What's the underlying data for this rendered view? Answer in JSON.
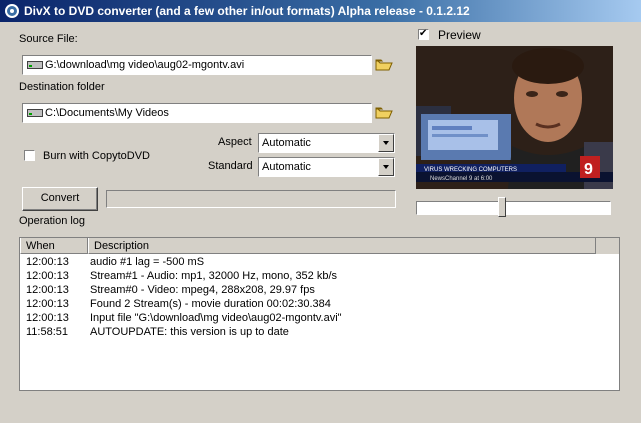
{
  "window": {
    "title": "DivX to DVD converter (and a few other in/out formats) Alpha release - 0.1.2.12"
  },
  "source": {
    "label": "Source File:",
    "value": "G:\\download\\mg video\\aug02-mgontv.avi"
  },
  "destination": {
    "label": "Destination folder",
    "value": "C:\\Documents\\My Videos"
  },
  "burn": {
    "label": "Burn with CopytoDVD",
    "checked": false
  },
  "aspect": {
    "label": "Aspect",
    "value": "Automatic"
  },
  "standard": {
    "label": "Standard",
    "value": "Automatic"
  },
  "convert": {
    "label": "Convert",
    "progress": 0
  },
  "preview": {
    "label": "Preview",
    "checked": true,
    "position": 0.43
  },
  "log": {
    "title": "Operation log",
    "columns": [
      "When",
      "Description"
    ],
    "rows": [
      [
        "12:00:13",
        "audio #1 lag = -500 mS"
      ],
      [
        "12:00:13",
        "Stream#1 - Audio: mp1, 32000 Hz, mono, 352 kb/s"
      ],
      [
        "12:00:13",
        "Stream#0 - Video: mpeg4, 288x208, 29.97 fps"
      ],
      [
        "12:00:13",
        "Found 2 Stream(s) - movie duration 00:02:30.384"
      ],
      [
        "12:00:13",
        "Input file \"G:\\download\\mg video\\aug02-mgontv.avi\""
      ],
      [
        "11:58:51",
        "AUTOUPDATE: this version is up to date"
      ]
    ]
  },
  "colors": {
    "face": "#d4d0c8",
    "title_start": "#0a246a",
    "title_end": "#a6caf0"
  }
}
